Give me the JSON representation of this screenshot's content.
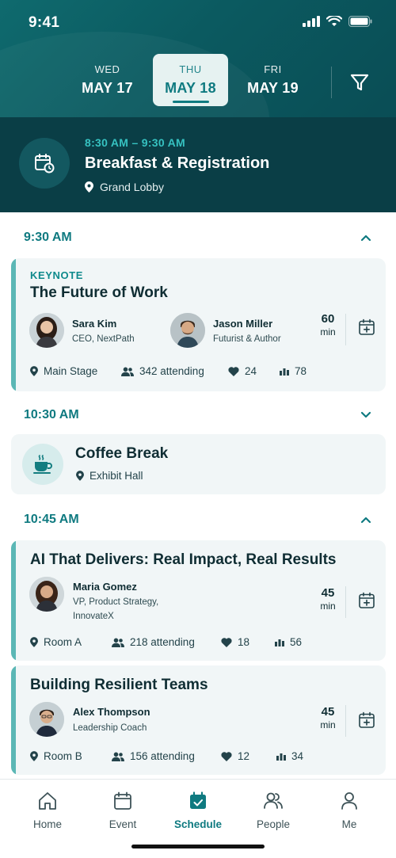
{
  "status": {
    "time": "9:41"
  },
  "days": [
    {
      "dow": "WED",
      "date": "MAY 17",
      "active": false
    },
    {
      "dow": "THU",
      "date": "MAY 18",
      "active": true
    },
    {
      "dow": "FRI",
      "date": "MAY 19",
      "active": false
    }
  ],
  "current": {
    "time": "8:30 AM – 9:30 AM",
    "title": "Breakfast & Registration",
    "location": "Grand Lobby"
  },
  "sections": [
    {
      "time": "9:30 AM"
    },
    {
      "time": "10:30 AM"
    },
    {
      "time": "10:45 AM"
    }
  ],
  "sessions": [
    {
      "tag": "KEYNOTE",
      "title": "The Future of Work",
      "speakers": [
        {
          "name": "Sara Kim",
          "role": "CEO, NextPath"
        },
        {
          "name": "Jason Miller",
          "role": "Futurist & Author"
        }
      ],
      "duration": "60",
      "unit": "min",
      "location": "Main Stage",
      "attending": "342 attending",
      "likes": "24",
      "views": "78"
    },
    {
      "title": "Coffee Break",
      "location": "Exhibit Hall"
    },
    {
      "title": "AI That Delivers: Real Impact, Real Results",
      "speakers": [
        {
          "name": "Maria Gomez",
          "role_line1": "VP, Product Strategy,",
          "role_line2": "InnovateX"
        }
      ],
      "duration": "45",
      "unit": "min",
      "location": "Room A",
      "attending": "218 attending",
      "likes": "18",
      "views": "56"
    },
    {
      "title": "Building Resilient Teams",
      "speakers": [
        {
          "name": "Alex Thompson",
          "role": "Leadership Coach"
        }
      ],
      "duration": "45",
      "unit": "min",
      "location": "Room B",
      "attending": "156 attending",
      "likes": "12",
      "views": "34"
    }
  ],
  "nav": [
    {
      "label": "Home",
      "icon": "home-icon"
    },
    {
      "label": "Event",
      "icon": "calendar-icon"
    },
    {
      "label": "Schedule",
      "icon": "schedule-icon",
      "active": true
    },
    {
      "label": "People",
      "icon": "people-icon"
    },
    {
      "label": "Me",
      "icon": "person-icon"
    }
  ],
  "colors": {
    "accent": "#0f7a80",
    "header": "#0b5a60",
    "banner": "#0a3e46",
    "card": "#f1f6f7"
  }
}
